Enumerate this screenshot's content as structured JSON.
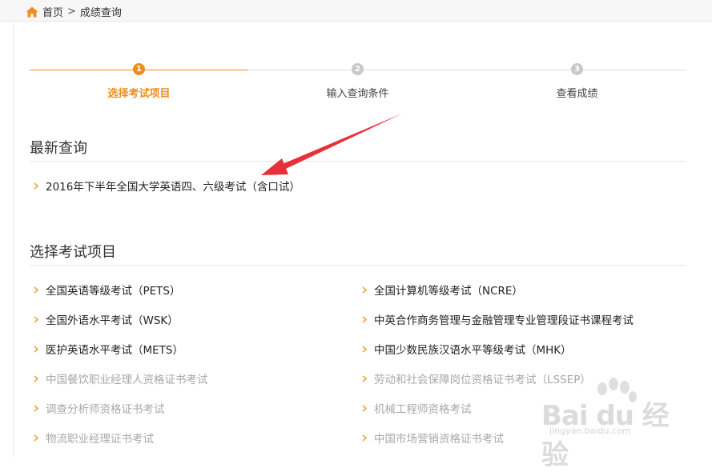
{
  "breadcrumb": {
    "home": "首页",
    "separator": ">",
    "current": "成绩查询"
  },
  "steps": [
    {
      "number": "1",
      "label": "选择考试项目",
      "state": "active"
    },
    {
      "number": "2",
      "label": "输入查询条件",
      "state": "inactive"
    },
    {
      "number": "3",
      "label": "查看成绩",
      "state": "inactive"
    }
  ],
  "recent": {
    "title": "最新查询",
    "items": [
      "2016年下半年全国大学英语四、六级考试（含口试）"
    ]
  },
  "projects": {
    "title": "选择考试项目",
    "left": [
      {
        "label": "全国英语等级考试（PETS）",
        "enabled": true
      },
      {
        "label": "全国外语水平考试（WSK）",
        "enabled": true
      },
      {
        "label": "医护英语水平考试（METS）",
        "enabled": true
      },
      {
        "label": "中国餐饮职业经理人资格证书考试",
        "enabled": false
      },
      {
        "label": "调查分析师资格证书考试",
        "enabled": false
      },
      {
        "label": "物流职业经理证书考试",
        "enabled": false
      }
    ],
    "right": [
      {
        "label": "全国计算机等级考试（NCRE）",
        "enabled": true
      },
      {
        "label": "中英合作商务管理与金融管理专业管理段证书课程考试",
        "enabled": true
      },
      {
        "label": "中国少数民族汉语水平等级考试（MHK）",
        "enabled": true
      },
      {
        "label": "劳动和社会保障岗位资格证书考试（LSSEP）",
        "enabled": false
      },
      {
        "label": "机械工程师资格考试",
        "enabled": false
      },
      {
        "label": "中国市场营销资格证书考试",
        "enabled": false
      }
    ]
  },
  "watermark": {
    "brand": "Bai du 经验",
    "url": "jingyan.baidu.com"
  },
  "colors": {
    "accent": "#f08c1e",
    "inactive_step": "#c8c8c8",
    "annotation_arrow": "#e8303a"
  }
}
